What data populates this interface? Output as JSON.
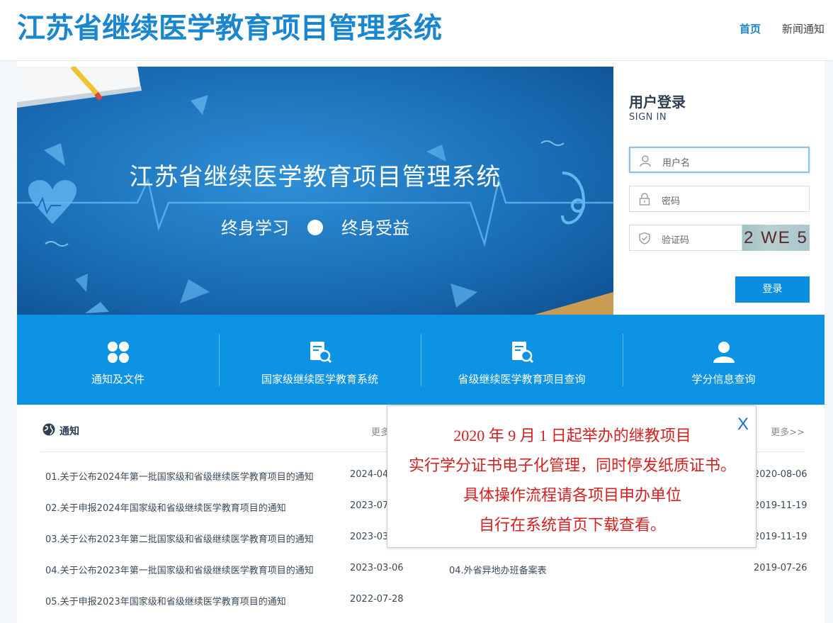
{
  "header": {
    "site_title": "江苏省继续医学教育项目管理系统",
    "nav": [
      {
        "label": "首页",
        "active": true
      },
      {
        "label": "新闻通知",
        "active": false
      }
    ]
  },
  "banner": {
    "title": "江苏省继续医学教育项目管理系统",
    "slogan_left": "终身学习",
    "slogan_right": "终身受益"
  },
  "login": {
    "title": "用户登录",
    "subtitle": "SIGN IN",
    "username_placeholder": "用户名",
    "password_placeholder": "密码",
    "captcha_placeholder": "验证码",
    "captcha_text": "2 WE 5",
    "button_label": "登录"
  },
  "quick_links": [
    {
      "label": "通知及文件",
      "icon": "clover-icon"
    },
    {
      "label": "国家级继续医学教育系统",
      "icon": "doc-search-icon"
    },
    {
      "label": "省级继续医学教育项目查询",
      "icon": "doc-search-icon"
    },
    {
      "label": "学分信息查询",
      "icon": "user-icon"
    }
  ],
  "notices": {
    "title": "通知",
    "more_left": "更多",
    "more_right": "更多>>",
    "left": [
      {
        "title": "01.关于公布2024年第一批国家级和省级继续医学教育项目的通知",
        "date": "2024-04-"
      },
      {
        "title": "02.关于申报2024年国家级和省级继续医学教育项目的通知",
        "date": "2023-07-"
      },
      {
        "title": "03.关于公布2023年第二批国家级和省级继续医学教育项目的通知",
        "date": "2023-03-"
      },
      {
        "title": "04.关于公布2023年第一批国家级和省级继续医学教育项目的通知",
        "date": "2023-03-06"
      },
      {
        "title": "05.关于申报2023年国家级和省级继续医学教育项目的通知",
        "date": "2022-07-28"
      }
    ],
    "right": [
      {
        "title": "",
        "date": "2020-08-06"
      },
      {
        "title": "",
        "date": "2019-11-19"
      },
      {
        "title": "",
        "date": "2019-11-19"
      },
      {
        "title": "04.外省异地办班备案表",
        "date": "2019-07-26"
      }
    ]
  },
  "popup": {
    "close_label": "X",
    "lines": [
      "2020 年 9 月 1 日起举办的继教项目",
      "实行学分证书电子化管理，同时停发纸质证书。",
      "具体操作流程请各项目申办单位",
      "自行在系统首页下载查看。"
    ]
  },
  "colors": {
    "brand": "#1a86d0",
    "quick_bar": "#0d93e4",
    "popup_text": "#d42020"
  }
}
